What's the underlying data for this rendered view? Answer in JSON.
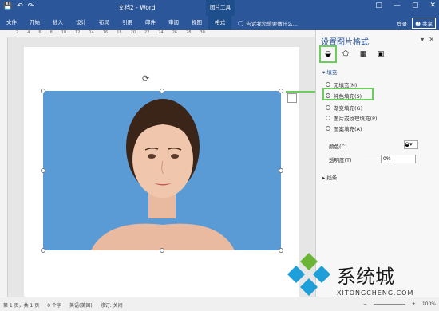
{
  "titlebar": {
    "doc_title": "文档2 - Word",
    "context_title": "图片工具",
    "qa_icons": [
      "save-icon",
      "undo-icon",
      "redo-icon"
    ]
  },
  "ribbon": {
    "tabs": [
      {
        "label": "文件"
      },
      {
        "label": "开始"
      },
      {
        "label": "插入"
      },
      {
        "label": "设计"
      },
      {
        "label": "布局"
      },
      {
        "label": "引用"
      },
      {
        "label": "邮件"
      },
      {
        "label": "审阅"
      },
      {
        "label": "视图"
      },
      {
        "label": "格式",
        "active": true
      }
    ],
    "tell_me": "告诉我您想要做什么...",
    "login": "登录",
    "share": "共享"
  },
  "ruler": {
    "numbers": [
      "2",
      "4",
      "6",
      "8",
      "10",
      "12",
      "14",
      "16",
      "18",
      "20",
      "22",
      "24",
      "26",
      "28",
      "30"
    ]
  },
  "format_pane": {
    "title": "设置图片格式",
    "section_fill": "填充",
    "options": [
      {
        "label": "无填充(N)",
        "selected": false
      },
      {
        "label": "纯色填充(S)",
        "selected": true
      },
      {
        "label": "渐变填充(G)",
        "selected": false
      },
      {
        "label": "图片或纹理填充(P)",
        "selected": false
      },
      {
        "label": "图案填充(A)",
        "selected": false
      }
    ],
    "color_label": "颜色(C)",
    "transparency_label": "透明度(T)",
    "transparency_value": "0%",
    "section_line": "线条"
  },
  "statusbar": {
    "page": "第 1 页，共 1 页",
    "words": "0 个字",
    "language": "英语(美国)",
    "track": "修订: 关闭",
    "zoom": "100%"
  },
  "watermark": {
    "cn": "系统城",
    "en": "XITONGCHENG.COM"
  },
  "colors": {
    "accent": "#2b579a",
    "highlight": "#6ccc5e",
    "image_bg": "#5b9bd5"
  }
}
